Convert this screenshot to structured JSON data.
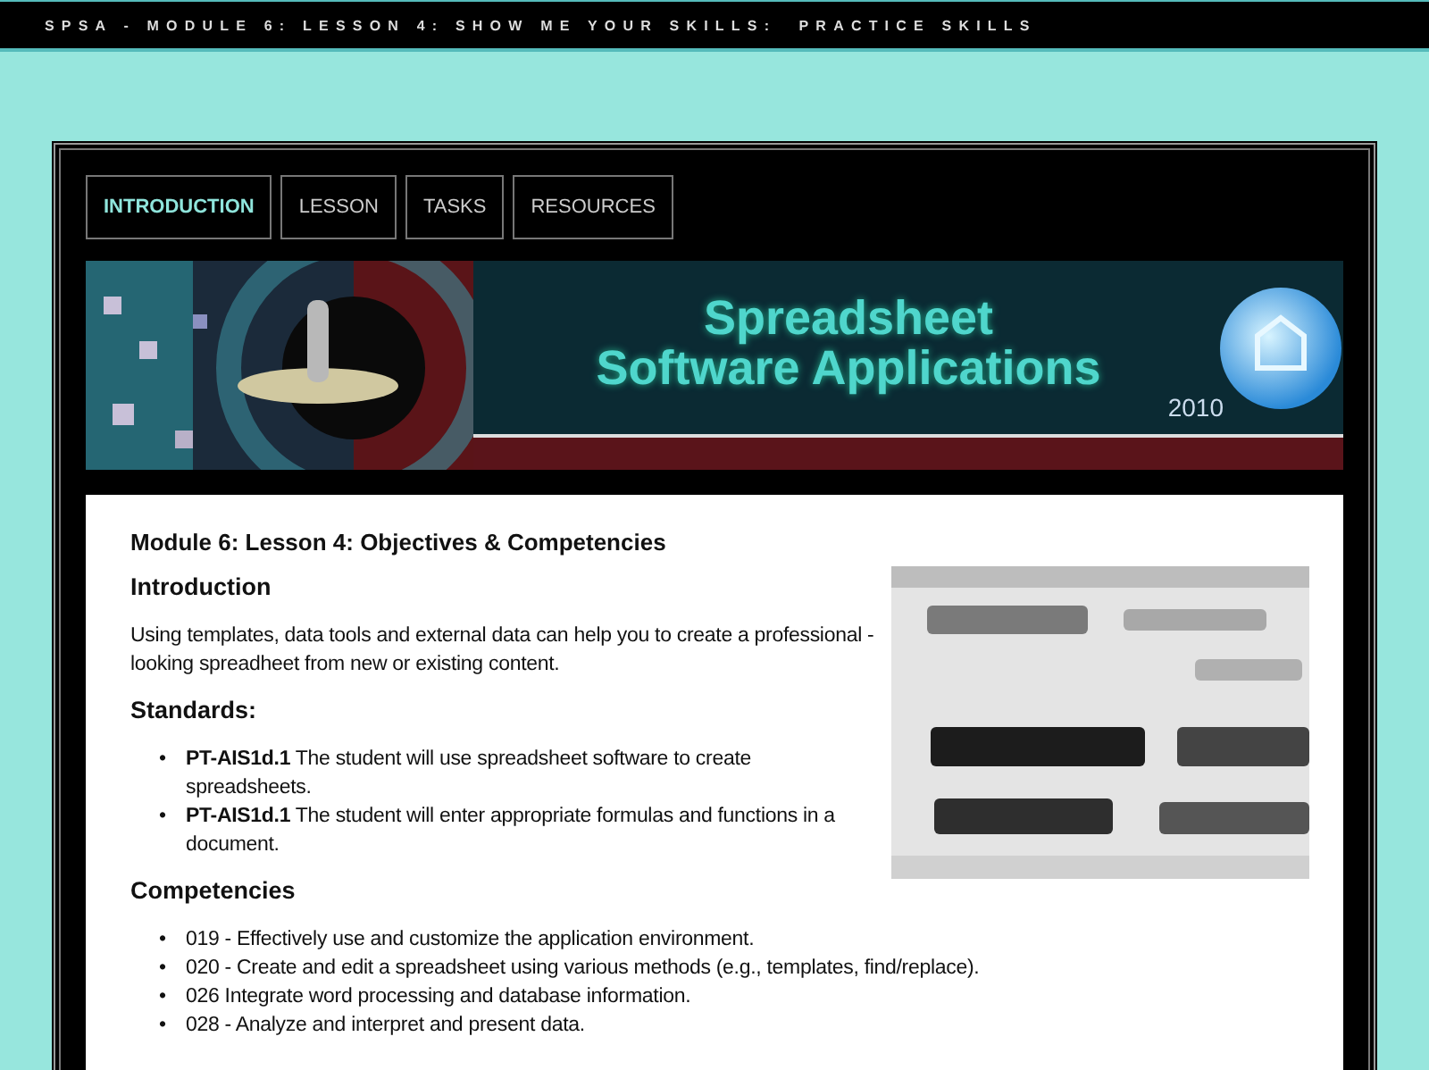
{
  "top_bar": {
    "title": "SPSA - MODULE 6: LESSON 4: SHOW ME YOUR SKILLS:  PRACTICE SKILLS"
  },
  "tabs": [
    {
      "label": "INTRODUCTION",
      "selected": true
    },
    {
      "label": "LESSON",
      "selected": false
    },
    {
      "label": "TASKS",
      "selected": false
    },
    {
      "label": "RESOURCES",
      "selected": false
    }
  ],
  "banner": {
    "title_line_1": "Spreadsheet",
    "title_line_2": "Software Applications",
    "year": "2010"
  },
  "content": {
    "heading": "Module 6: Lesson 4: Objectives & Competencies",
    "sections": [
      {
        "kind": "paragraph",
        "title": "Introduction",
        "text": "Using templates, data tools and external data can help you to create a professional -looking spreadheet from new or existing content."
      },
      {
        "kind": "list",
        "title": "Standards:",
        "items": [
          {
            "bullet": "•",
            "text": "**PT-AIS1d.1** The student will use spreadsheet software to create spreadsheets."
          },
          {
            "bullet": "•",
            "text": "**PT-AIS1d.1** The student will enter appropriate formulas and functions in a document."
          }
        ]
      },
      {
        "kind": "list",
        "title": "Competencies",
        "items": [
          {
            "bullet": "•",
            "text": "019 - Effectively use and customize the application environment."
          },
          {
            "bullet": "•",
            "text": "020 - Create and edit a spreadsheet using various methods (e.g., templates, find/replace)."
          },
          {
            "bullet": "•",
            "text": "026 Integrate word processing and database information."
          },
          {
            "bullet": "•",
            "text": "028 - Analyze and interpret and present data."
          }
        ]
      }
    ]
  }
}
